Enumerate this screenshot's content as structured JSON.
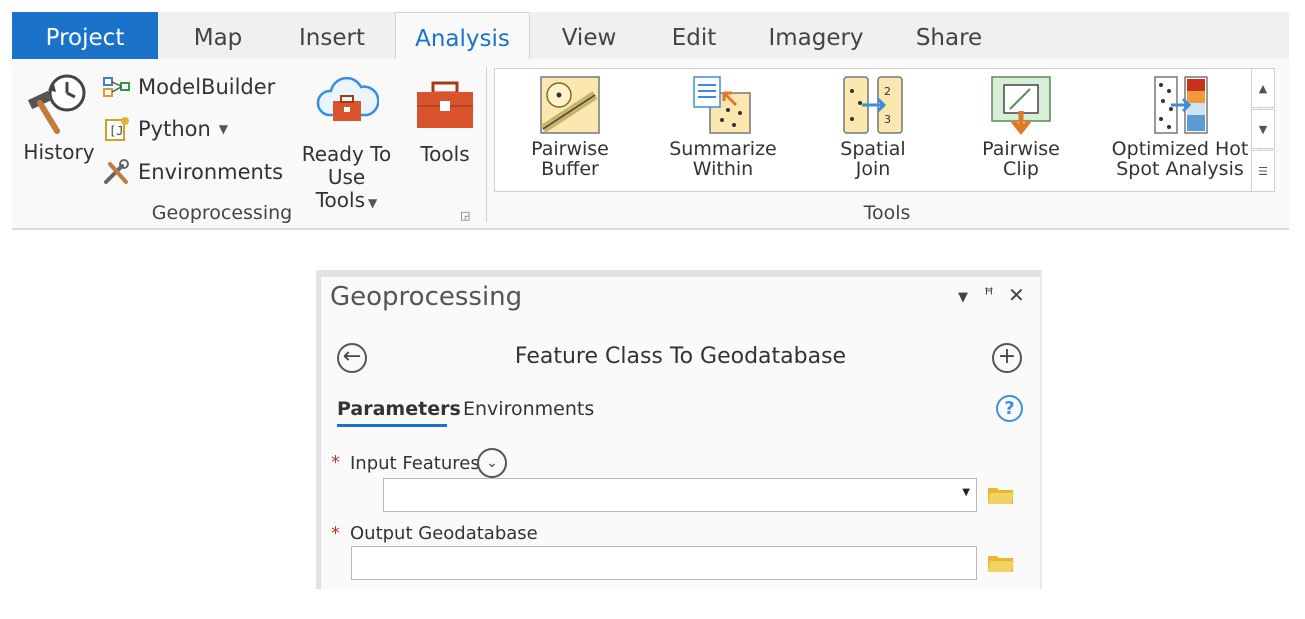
{
  "ribbon": {
    "tabs": {
      "project": "Project",
      "map": "Map",
      "insert": "Insert",
      "analysis": "Analysis",
      "view": "View",
      "edit": "Edit",
      "imagery": "Imagery",
      "share": "Share"
    },
    "active_tab": "Analysis",
    "geoprocessing_group": {
      "label": "Geoprocessing",
      "history": "History",
      "modelbuilder": "ModelBuilder",
      "python": "Python",
      "environments": "Environments",
      "ready_to_use_line1": "Ready To",
      "ready_to_use_line2": "Use Tools",
      "tools": "Tools"
    },
    "tools_group": {
      "label": "Tools",
      "items": [
        {
          "line1": "Pairwise",
          "line2": "Buffer"
        },
        {
          "line1": "Summarize",
          "line2": "Within"
        },
        {
          "line1": "Spatial",
          "line2": "Join"
        },
        {
          "line1": "Pairwise",
          "line2": "Clip"
        },
        {
          "line1": "Optimized Hot",
          "line2": "Spot Analysis"
        }
      ]
    },
    "colors": {
      "accent": "#1a73c9",
      "tabbar_bg": "#f0f0f0",
      "panel_bg": "#f9f9f9",
      "toolbox_red": "#d9532c"
    }
  },
  "geoprocessing_pane": {
    "title": "Geoprocessing",
    "tool_name": "Feature Class To Geodatabase",
    "tabs": {
      "parameters": "Parameters",
      "environments": "Environments"
    },
    "active_tab": "Parameters",
    "params": {
      "input_features": {
        "label": "Input Features",
        "required": "*",
        "value": ""
      },
      "output_geodatabase": {
        "label": "Output Geodatabase",
        "required": "*",
        "value": ""
      }
    },
    "colors": {
      "required_star": "#c0392b",
      "help": "#3c90dc",
      "folder": "#e8b92f"
    }
  }
}
